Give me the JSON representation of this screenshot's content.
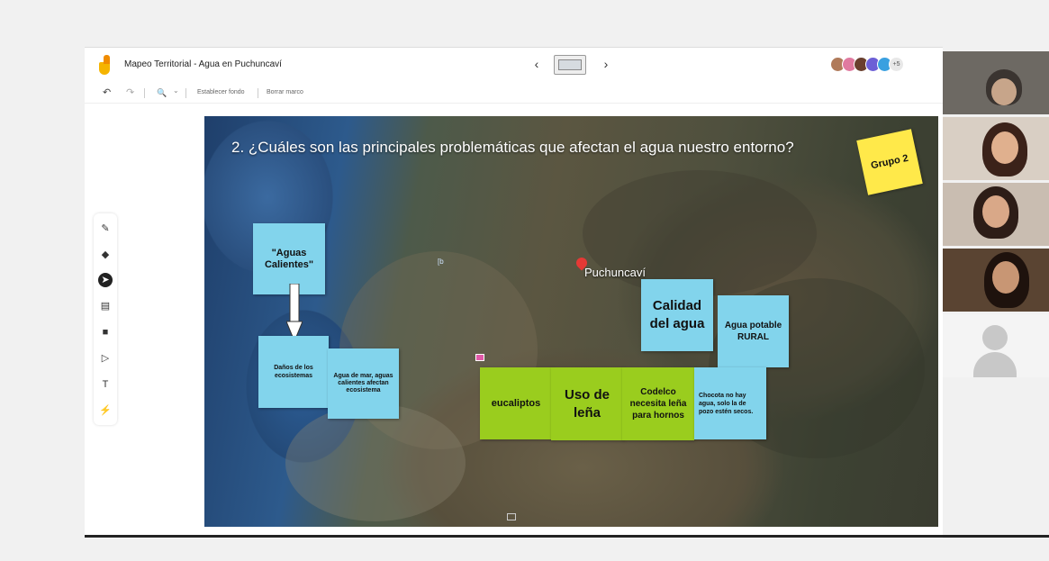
{
  "app": {
    "title": "Mapeo Territorial - Agua en Puchuncaví",
    "nav_prev": "‹",
    "nav_next": "›",
    "frame_thumb_label": "frame",
    "collaborators": [
      {
        "color": "#b07a5a"
      },
      {
        "color": "#e07aa0"
      },
      {
        "color": "#6a3f2e"
      },
      {
        "color": "#6c5fd6"
      },
      {
        "color": "#3aa0e0"
      }
    ],
    "collaborators_more": "+5"
  },
  "toolbar": {
    "undo": "↶",
    "redo": "↷",
    "zoom": "🔍",
    "zoom_caret": "⌄",
    "set_background": "Establecer fondo",
    "delete_frame": "Borrar marco"
  },
  "tools": [
    {
      "name": "pen-tool",
      "glyph": "✎"
    },
    {
      "name": "eraser-tool",
      "glyph": "◆"
    },
    {
      "name": "select-tool",
      "glyph": "➤"
    },
    {
      "name": "sticky-note-tool",
      "glyph": "▤"
    },
    {
      "name": "image-tool",
      "glyph": "■"
    },
    {
      "name": "shape-tool",
      "glyph": "▷"
    },
    {
      "name": "text-box-tool",
      "glyph": "T"
    },
    {
      "name": "laser-tool",
      "glyph": "⚡"
    }
  ],
  "slide": {
    "question": "2. ¿Cuáles son las principales problemáticas que afectan el agua nuestro entorno?",
    "place_label": "Puchuncaví",
    "small_marker": "[b"
  },
  "notes": {
    "aguas_calientes": "\"Aguas Calientes\"",
    "danos": "Daños de los ecosistemas",
    "agua_de_mar": "Agua de mar, aguas calientes afectan ecosistema",
    "calidad": "Calidad del agua",
    "agua_potable": "Agua potable RURAL",
    "eucaliptos": "eucaliptos",
    "uso_lena": "Uso de leña",
    "codelco": "Codelco necesita leña para hornos",
    "chocota": "Chocota no hay agua, solo la de pozo estén secos.",
    "grupo": "Grupo 2"
  },
  "colors": {
    "note_blue": "#82d4ec",
    "note_green": "#9acd1e",
    "note_yellow": "#ffe94a"
  }
}
